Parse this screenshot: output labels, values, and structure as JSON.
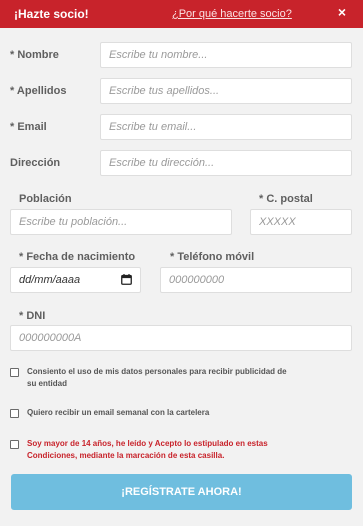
{
  "header": {
    "title": "¡Hazte socio!",
    "why_link": "¿Por qué hacerte socio?",
    "close_glyph": "×"
  },
  "form": {
    "nombre": {
      "label": "* Nombre",
      "placeholder": "Escribe tu nombre..."
    },
    "apellidos": {
      "label": "* Apellidos",
      "placeholder": "Escribe tus apellidos..."
    },
    "email": {
      "label": "* Email",
      "placeholder": "Escribe tu email..."
    },
    "direccion": {
      "label": "Dirección",
      "placeholder": "Escribe tu dirección..."
    },
    "poblacion": {
      "label": "Población",
      "placeholder": "Escribe tu población..."
    },
    "cpostal": {
      "label": "* C. postal",
      "placeholder": "XXXXX"
    },
    "fecha": {
      "label": "* Fecha de nacimiento",
      "value": "dd/mm/aaaa"
    },
    "telefono": {
      "label": "* Teléfono móvil",
      "placeholder": "000000000"
    },
    "dni": {
      "label": "* DNI",
      "placeholder": "000000000A"
    }
  },
  "checkboxes": [
    {
      "text": "Consiento el uso de mis datos personales para recibir publicidad de su entidad",
      "checked": false
    },
    {
      "text": "Quiero recibir un email semanal con la cartelera",
      "checked": false
    },
    {
      "text": "Soy mayor de 14 años, he leído y Acepto lo estipulado en estas Condiciones, mediante la marcación de esta casilla.",
      "checked": false
    }
  ],
  "submit_label": "¡REGÍSTRATE AHORA!",
  "colors": {
    "header_red": "#c8232b",
    "submit_blue": "#6fbedf",
    "background": "#f2f2f2"
  }
}
